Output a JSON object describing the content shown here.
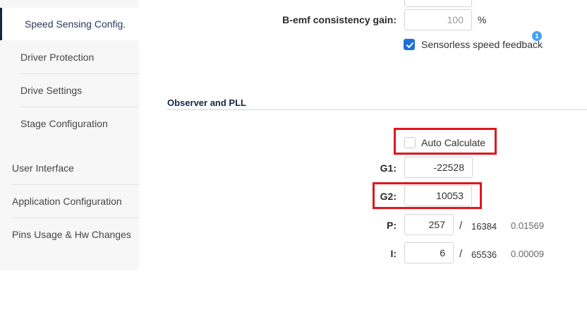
{
  "sidebar": {
    "items": [
      {
        "label": "Speed Sensing Config."
      },
      {
        "label": "Driver Protection"
      },
      {
        "label": "Drive Settings"
      },
      {
        "label": "Stage Configuration"
      },
      {
        "label": "User Interface"
      },
      {
        "label": "Application Configuration"
      },
      {
        "label": "Pins Usage & Hw Changes"
      }
    ]
  },
  "speed_sensing": {
    "bemf_label": "B-emf consistency gain:",
    "bemf_value": "100",
    "bemf_unit": "%",
    "sensorless_label": "Sensorless speed feedback",
    "sensorless_checked": true,
    "sensorless_badge": "1"
  },
  "observer": {
    "title": "Observer and PLL",
    "auto_calc_label": "Auto Calculate",
    "auto_calc_checked": false,
    "g1_label": "G1:",
    "g1_value": "-22528",
    "g2_label": "G2:",
    "g2_value": "10053",
    "p_label": "P:",
    "p_value": "257",
    "p_slash": "/",
    "p_divisor": "16384",
    "p_result": "0.01569",
    "i_label": "I:",
    "i_value": "6",
    "i_slash": "/",
    "i_divisor": "65536",
    "i_result": "0.00009"
  },
  "colors": {
    "accent": "#1e6fd9",
    "highlight": "#e0161e",
    "active_bar": "#14264a"
  }
}
